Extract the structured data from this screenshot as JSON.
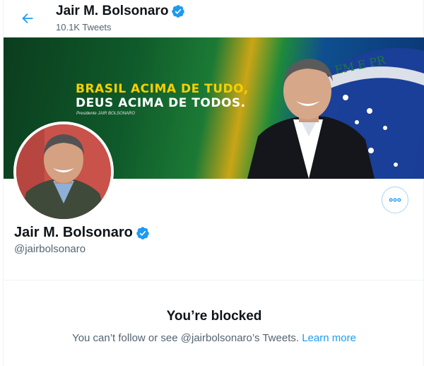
{
  "header": {
    "name": "Jair M. Bolsonaro",
    "tweet_count": "10.1K Tweets"
  },
  "banner": {
    "line1": "BRASIL ACIMA DE TUDO,",
    "line2": "DEUS ACIMA DE TODOS.",
    "credit": "Presidente JAIR BOLSONARO",
    "flag_text": "EM E PR"
  },
  "profile": {
    "name": "Jair M. Bolsonaro",
    "handle": "@jairbolsonaro"
  },
  "blocked": {
    "title": "You’re blocked",
    "message": "You can’t follow or see @jairbolsonaro’s Tweets.",
    "link": "Learn more"
  },
  "colors": {
    "accent": "#1d9bf0",
    "secondary_text": "#536471"
  },
  "icons": {
    "back": "back-arrow-icon",
    "verified": "verified-badge-icon",
    "more": "more-dots-icon"
  }
}
